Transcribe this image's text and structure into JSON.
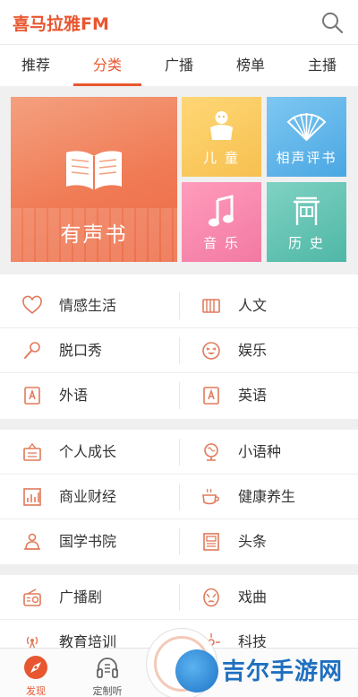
{
  "app": {
    "logo_text": "喜马拉雅FM"
  },
  "header": {
    "search_icon": "search-icon"
  },
  "tabs": [
    {
      "label": "推荐",
      "active": false
    },
    {
      "label": "分类",
      "active": true
    },
    {
      "label": "广播",
      "active": false
    },
    {
      "label": "榜单",
      "active": false
    },
    {
      "label": "主播",
      "active": false
    }
  ],
  "banner": {
    "big": {
      "label": "有声书",
      "icon": "open-book-icon"
    },
    "tiles": [
      {
        "label": "儿 童",
        "icon": "baby-icon",
        "color": "#f6c04f"
      },
      {
        "label": "相声评书",
        "icon": "folding-fan-icon",
        "color": "#4aa7e2"
      },
      {
        "label": "音 乐",
        "icon": "music-note-icon",
        "color": "#f279a2"
      },
      {
        "label": "历 史",
        "icon": "ancient-gate-icon",
        "color": "#4fb7a6"
      }
    ]
  },
  "categories": {
    "group1": [
      {
        "left": "情感生活",
        "left_icon": "heart-icon",
        "right": "人文",
        "right_icon": "scroll-icon"
      },
      {
        "left": "脱口秀",
        "left_icon": "microphone-icon",
        "right": "娱乐",
        "right_icon": "laugh-face-icon"
      },
      {
        "left": "外语",
        "left_icon": "letter-a-book-icon",
        "right": "英语",
        "right_icon": "letter-a-book-icon"
      }
    ],
    "group2": [
      {
        "left": "个人成长",
        "left_icon": "signboard-icon",
        "right": "小语种",
        "right_icon": "globe-icon"
      },
      {
        "left": "商业财经",
        "left_icon": "chart-icon",
        "right": "健康养生",
        "right_icon": "tea-cup-icon"
      },
      {
        "left": "国学书院",
        "left_icon": "scholar-icon",
        "right": "头条",
        "right_icon": "newspaper-icon"
      }
    ],
    "group3": [
      {
        "left": "广播剧",
        "left_icon": "radio-icon",
        "right": "戏曲",
        "right_icon": "opera-mask-icon"
      },
      {
        "left": "教育培训",
        "left_icon": "broadcast-icon",
        "right": "科技",
        "right_icon": "tech-icon"
      }
    ]
  },
  "bottom_bar": [
    {
      "label": "发现",
      "icon": "compass-icon",
      "active": true
    },
    {
      "label": "定制听",
      "icon": "headphones-icon",
      "active": false
    }
  ],
  "watermark": {
    "text": "吉尔手游网"
  },
  "colors": {
    "accent": "#e8562f",
    "icon_stroke": "#e07a5a"
  }
}
